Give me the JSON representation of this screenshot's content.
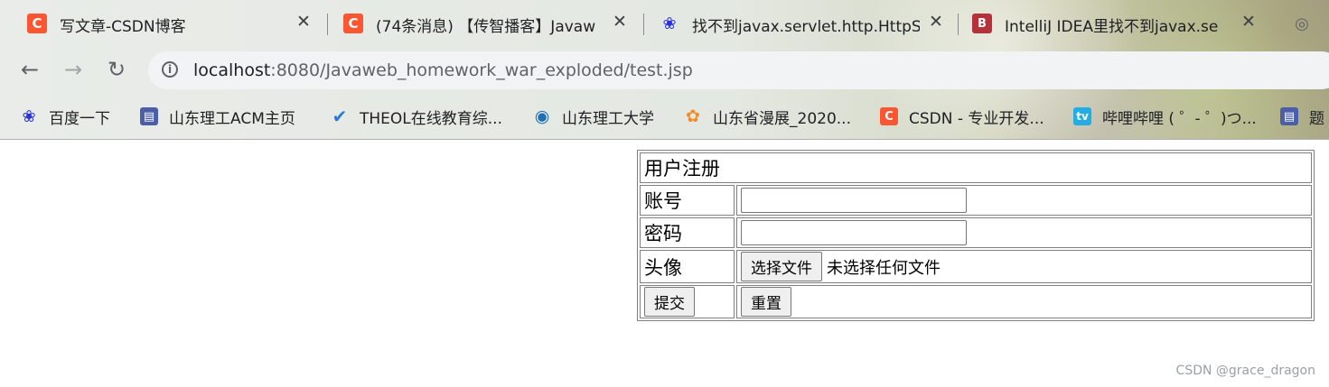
{
  "tabs": [
    {
      "title": "写文章-CSDN博客",
      "favicon": "csdn-icon",
      "favicon_color": "#fc5531"
    },
    {
      "title": "(74条消息) 【传智播客】Javaw",
      "favicon": "csdn-icon",
      "favicon_color": "#fc5531"
    },
    {
      "title": "找不到javax.servlet.http.HttpS",
      "favicon": "baidu-paw-icon",
      "favicon_color": "#2932e1"
    },
    {
      "title": "IntelliJ IDEA里找不到javax.se",
      "favicon": "jetbrains-icon",
      "favicon_color": "#b5323a"
    },
    {
      "title": "",
      "favicon": "generic-icon",
      "favicon_color": "#5f6368"
    }
  ],
  "toolbar": {
    "back_glyph": "←",
    "forward_glyph": "→",
    "reload_glyph": "↻",
    "url_host": "localhost",
    "url_rest": ":8080/Javaweb_homework_war_exploded/test.jsp"
  },
  "bookmarks": [
    {
      "label": "百度一下",
      "icon": "baidu-paw-icon",
      "color": "#2932e1"
    },
    {
      "label": "山东理工ACM主页",
      "icon": "acm-icon",
      "color": "#4a5fa8"
    },
    {
      "label": "THEOL在线教育综...",
      "icon": "theol-icon",
      "color": "#2c7ad6"
    },
    {
      "label": "山东理工大学",
      "icon": "sdut-icon",
      "color": "#1e6fb4"
    },
    {
      "label": "山东省漫展_2020...",
      "icon": "anime-expo-icon",
      "color": "#f28c28"
    },
    {
      "label": "CSDN - 专业开发...",
      "icon": "csdn-icon",
      "color": "#fc5531"
    },
    {
      "label": "哔哩哔哩 ( ゜- ゜)つ...",
      "icon": "bilibili-icon",
      "color": "#23ade5"
    },
    {
      "label": "题",
      "icon": "folder-icon",
      "color": "#4a5fa8"
    }
  ],
  "form": {
    "title": "用户注册",
    "account_label": "账号",
    "account_value": "",
    "password_label": "密码",
    "password_value": "",
    "avatar_label": "头像",
    "file_button": "选择文件",
    "file_status": "未选择任何文件",
    "submit_label": "提交",
    "reset_label": "重置"
  },
  "watermark": "CSDN @grace_dragon"
}
